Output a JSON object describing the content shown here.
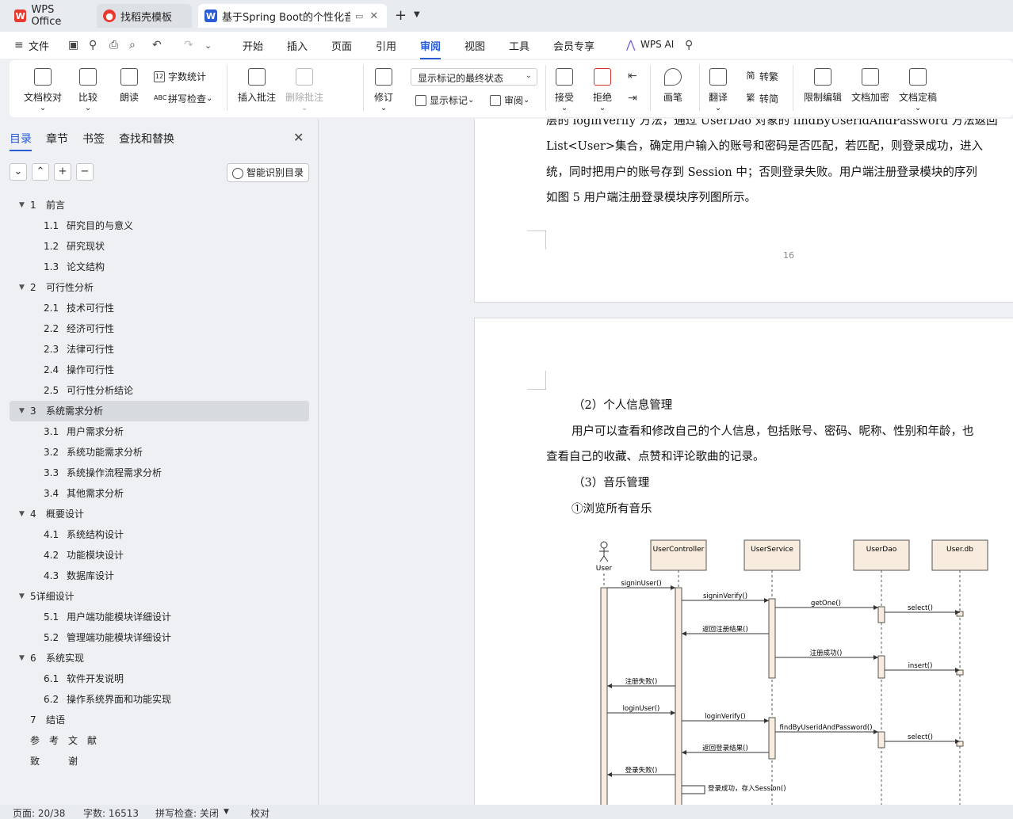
{
  "tabs": [
    {
      "label": "WPS Office",
      "icon": "wps-logo-icon"
    },
    {
      "label": "找稻壳模板",
      "icon": "docer-logo-icon"
    },
    {
      "label": "基于Spring Boot的个性化音乐",
      "icon": "word-doc-icon"
    }
  ],
  "menu": {
    "file": "文件",
    "items": [
      "开始",
      "插入",
      "页面",
      "引用",
      "审阅",
      "视图",
      "工具",
      "会员专享"
    ],
    "active": "审阅",
    "ai": "WPS AI"
  },
  "ribbon": {
    "doc_check": "文档校对",
    "compare": "比较",
    "read_aloud": "朗读",
    "word_count": "字数统计",
    "spell_check": "拼写检查",
    "insert_comment": "插入批注",
    "delete_comment": "删除批注",
    "revise": "修订",
    "markup_state": "显示标记的最终状态",
    "show_markup": "显示标记",
    "review": "审阅",
    "accept": "接受",
    "reject": "拒绝",
    "draw": "画笔",
    "translate": "翻译",
    "to_traditional": "转繁",
    "to_simplified": "转简",
    "restrict_edit": "限制编辑",
    "encrypt": "文档加密",
    "finalize": "文档定稿"
  },
  "sidebar": {
    "tabs": [
      "目录",
      "章节",
      "书签",
      "查找和替换"
    ],
    "smart_btn": "智能识别目录",
    "toc": [
      {
        "num": "1",
        "title": "前言",
        "level": 1,
        "expand": true
      },
      {
        "num": "1.1",
        "title": "研究目的与意义",
        "level": 2
      },
      {
        "num": "1.2",
        "title": "研究现状",
        "level": 2
      },
      {
        "num": "1.3",
        "title": "论文结构",
        "level": 2
      },
      {
        "num": "2",
        "title": "可行性分析",
        "level": 1,
        "expand": true
      },
      {
        "num": "2.1",
        "title": "技术可行性",
        "level": 2
      },
      {
        "num": "2.2",
        "title": "经济可行性",
        "level": 2
      },
      {
        "num": "2.3",
        "title": "法律可行性",
        "level": 2
      },
      {
        "num": "2.4",
        "title": "操作可行性",
        "level": 2
      },
      {
        "num": "2.5",
        "title": "可行性分析结论",
        "level": 2
      },
      {
        "num": "3",
        "title": "系统需求分析",
        "level": 1,
        "expand": true,
        "selected": true
      },
      {
        "num": "3.1",
        "title": "用户需求分析",
        "level": 2
      },
      {
        "num": "3.2",
        "title": "系统功能需求分析",
        "level": 2
      },
      {
        "num": "3.3",
        "title": "系统操作流程需求分析",
        "level": 2
      },
      {
        "num": "3.4",
        "title": "其他需求分析",
        "level": 2
      },
      {
        "num": "4",
        "title": "概要设计",
        "level": 1,
        "expand": true
      },
      {
        "num": "4.1",
        "title": "系统结构设计",
        "level": 2
      },
      {
        "num": "4.2",
        "title": "功能模块设计",
        "level": 2
      },
      {
        "num": "4.3",
        "title": "数据库设计",
        "level": 2
      },
      {
        "num": "",
        "title": "5详细设计",
        "level": 1,
        "expand": true
      },
      {
        "num": "5.1",
        "title": "用户端功能模块详细设计",
        "level": 2
      },
      {
        "num": "5.2",
        "title": "管理端功能模块详细设计",
        "level": 2
      },
      {
        "num": "6",
        "title": "系统实现",
        "level": 1,
        "expand": true
      },
      {
        "num": "6.1",
        "title": "软件开发说明",
        "level": 2
      },
      {
        "num": "6.2",
        "title": "操作系统界面和功能实现",
        "level": 2
      },
      {
        "num": "7",
        "title": "结语",
        "level": 1,
        "expand": false
      },
      {
        "num": "",
        "title": "参　考　文　献",
        "level": 1,
        "expand": false
      },
      {
        "num": "",
        "title": "致　　　谢",
        "level": 1,
        "expand": false
      }
    ]
  },
  "document": {
    "page1_lines": [
      "层的 loginVerify 方法，通过 UserDao 对象的 findByUseridAndPassword 方法返回",
      "List<User>集合，确定用户输入的账号和密码是否匹配，若匹配，则登录成功，进入",
      "统，同时把用户的账号存到 Session 中；否则登录失败。用户端注册登录模块的序列",
      "如图 5 用户端注册登录模块序列图所示。"
    ],
    "page1_number": "16",
    "page2_lines": [
      "（2）个人信息管理",
      "用户可以查看和修改自己的个人信息，包括账号、密码、昵称、性别和年龄，也",
      "查看自己的收藏、点赞和评论歌曲的记录。",
      "（3）音乐管理",
      "①浏览所有音乐"
    ],
    "diagram": {
      "actor": "User",
      "lifelines": [
        "UserController",
        "UserService",
        "UserDao",
        "User.db"
      ],
      "messages": [
        "signinUser()",
        "signinVerify()",
        "getOne()",
        "select()",
        "返回注册结果()",
        "注册成功()",
        "insert()",
        "注册失败()",
        "loginUser()",
        "loginVerify()",
        "findByUseridAndPassword()",
        "select()",
        "返回登录结果()",
        "登录失败()",
        "登录成功，存入Session()"
      ]
    }
  },
  "status": {
    "page": "页面: 20/38",
    "words": "字数: 16513",
    "spell": "拼写检查: 关闭",
    "proof": "校对"
  }
}
